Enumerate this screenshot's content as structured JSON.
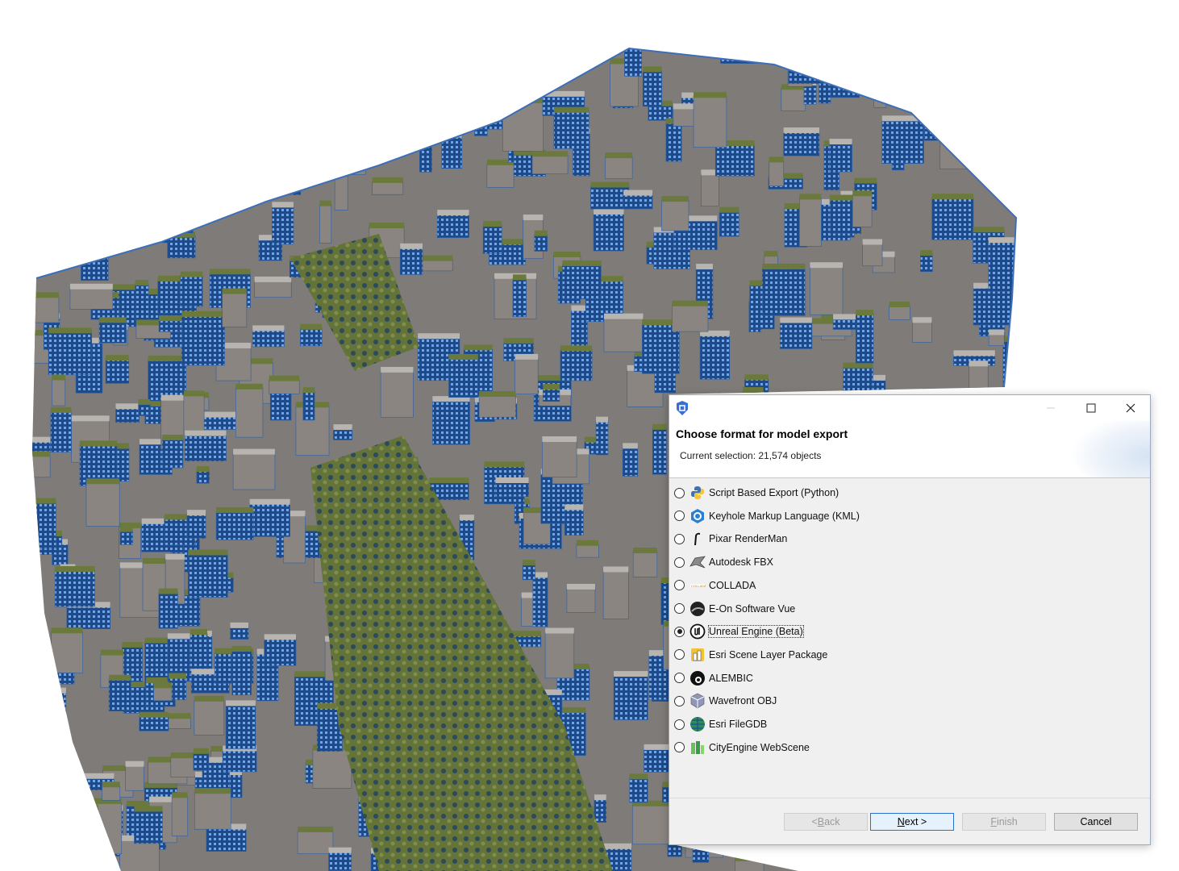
{
  "dialog": {
    "title": "Choose format for model export",
    "subtitle": "Current selection: 21,574 objects",
    "selected_index": 6,
    "options": [
      {
        "label": "Script Based Export (Python)",
        "icon": "python-icon"
      },
      {
        "label": "Keyhole Markup Language (KML)",
        "icon": "kml-icon"
      },
      {
        "label": "Pixar RenderMan",
        "icon": "renderman-icon"
      },
      {
        "label": "Autodesk FBX",
        "icon": "fbx-icon"
      },
      {
        "label": "COLLADA",
        "icon": "collada-icon"
      },
      {
        "label": "E-On Software Vue",
        "icon": "vue-icon"
      },
      {
        "label": "Unreal Engine (Beta)",
        "icon": "unreal-icon"
      },
      {
        "label": "Esri Scene Layer Package",
        "icon": "scene-layer-icon"
      },
      {
        "label": "ALEMBIC",
        "icon": "alembic-icon"
      },
      {
        "label": "Wavefront OBJ",
        "icon": "obj-icon"
      },
      {
        "label": "Esri FileGDB",
        "icon": "filegdb-icon"
      },
      {
        "label": "CityEngine WebScene",
        "icon": "webscene-icon"
      }
    ],
    "buttons": {
      "back": {
        "pre": "< ",
        "mnemonic": "B",
        "post": "ack"
      },
      "next": {
        "pre": "",
        "mnemonic": "N",
        "post": "ext >"
      },
      "finish": {
        "pre": "",
        "mnemonic": "F",
        "post": "inish"
      },
      "cancel": "Cancel"
    }
  },
  "colors": {
    "building_blue": "#1f4f8f",
    "roof_green": "#6b7a3c",
    "road_gray": "#8a8580",
    "park_green": "#5f6b32",
    "accent": "#2b6fd1"
  }
}
